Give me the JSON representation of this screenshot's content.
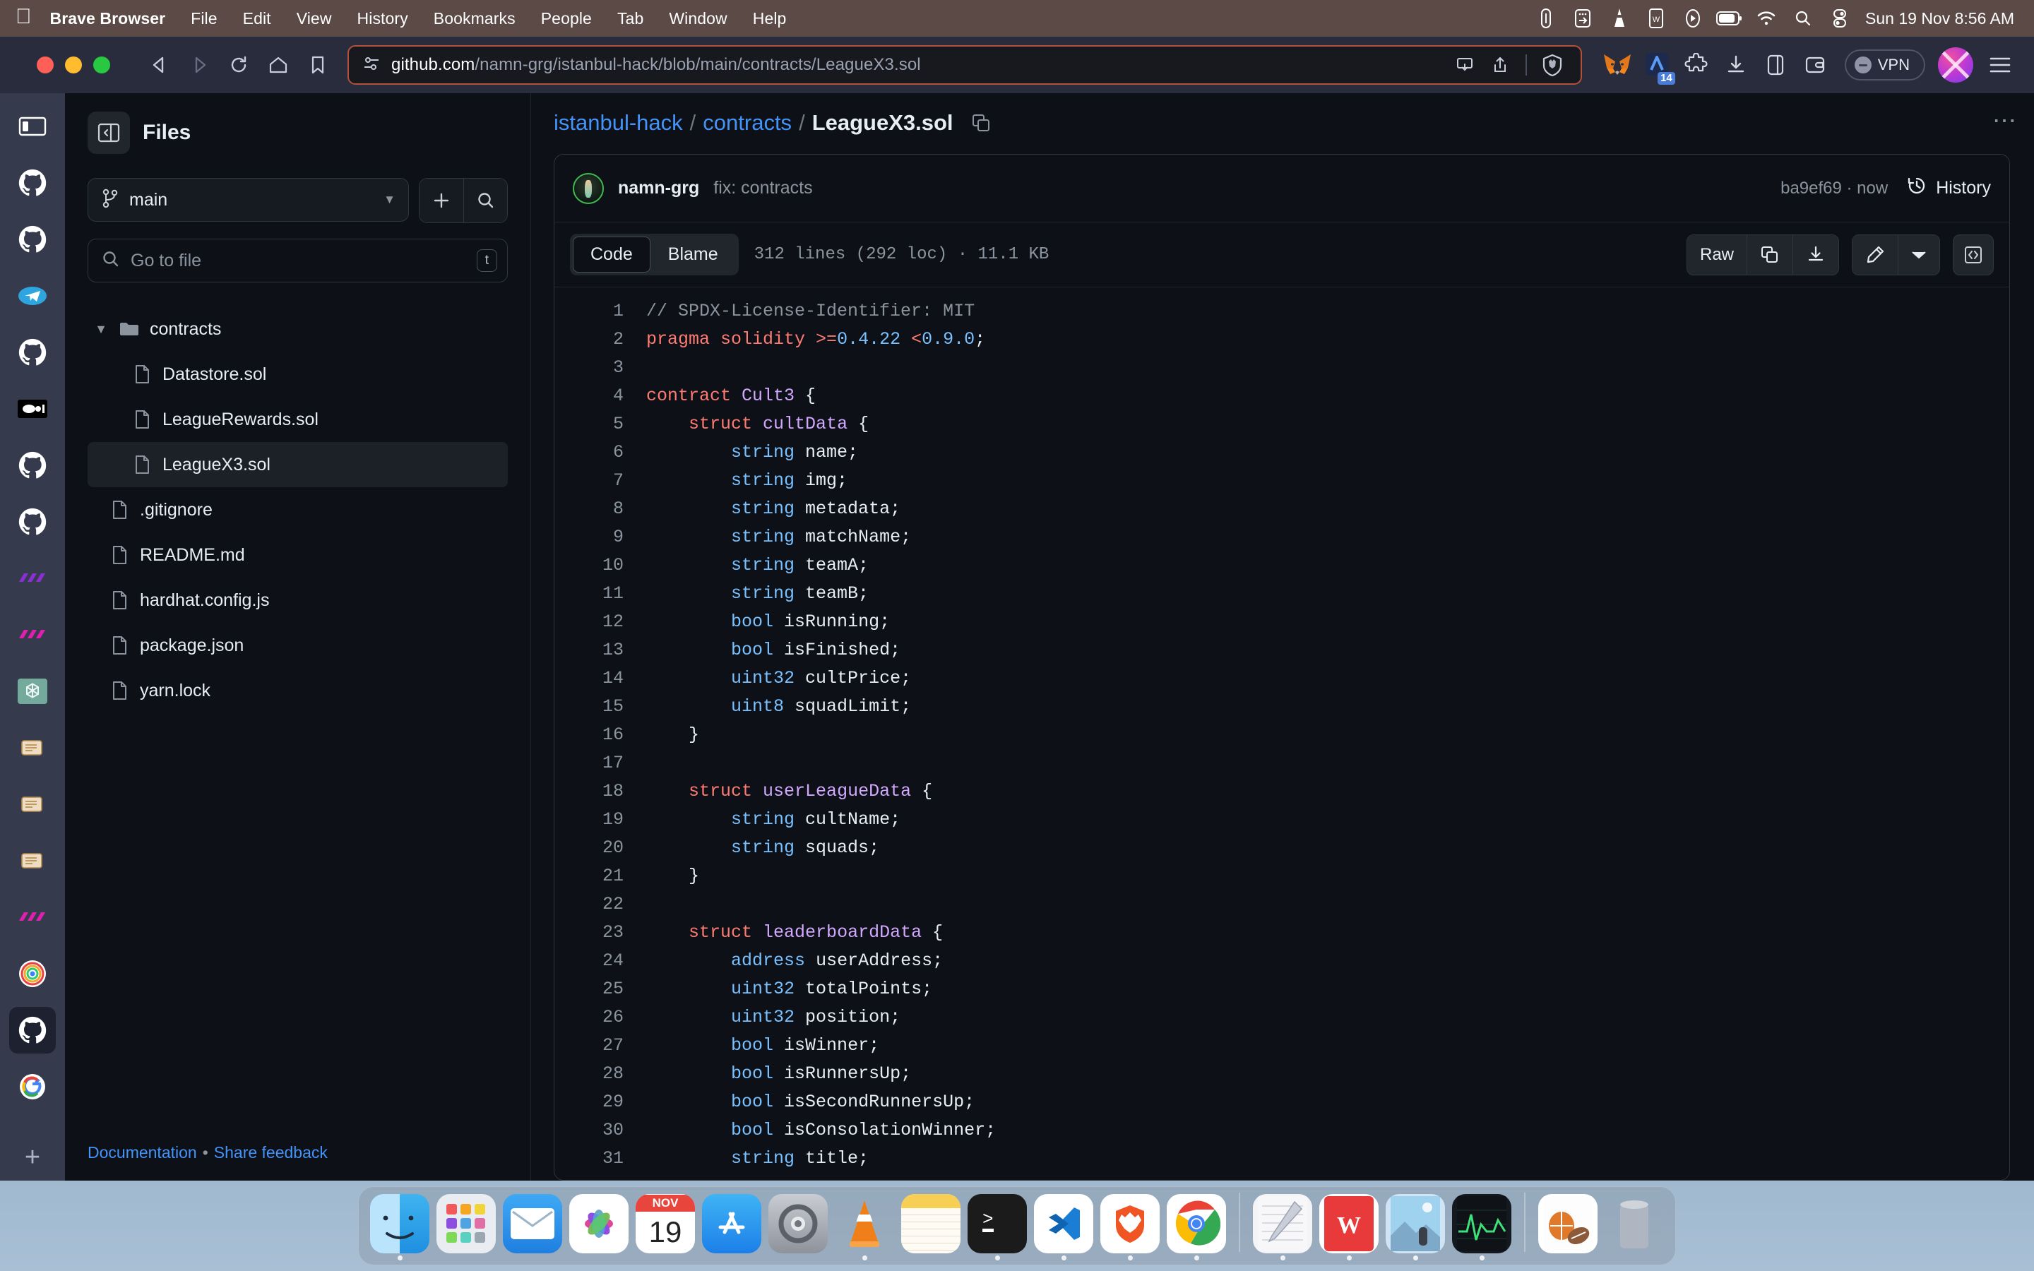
{
  "menubar": {
    "apple_icon": "apple-logo",
    "items": [
      "Brave Browser",
      "File",
      "Edit",
      "View",
      "History",
      "Bookmarks",
      "People",
      "Tab",
      "Window",
      "Help"
    ],
    "status_icons": [
      "paperclip-icon",
      "screen-mirroring-icon",
      "vlc-cone-icon",
      "wps-office-icon",
      "play-circle-icon",
      "battery-icon",
      "wifi-icon",
      "search-icon",
      "control-center-icon"
    ],
    "clock": "Sun 19 Nov  8:56 AM"
  },
  "browser": {
    "nav": {
      "back": "back-arrow-icon",
      "forward": "forward-arrow-icon",
      "reload": "reload-icon",
      "home": "home-icon",
      "bookmark": "bookmark-icon"
    },
    "url": {
      "site_settings_icon": "site-settings-icon",
      "host": "github.com",
      "path": "/namn-grg/istanbul-hack/blob/main/contracts/LeagueX3.sol",
      "full": "github.com/namn-grg/istanbul-hack/blob/main/contracts/LeagueX3.sol",
      "save_icon": "save-to-device-icon",
      "share_icon": "share-icon",
      "shields_icon": "brave-shields-icon"
    },
    "extensions": [
      {
        "name": "metamask-extension",
        "badge": ""
      },
      {
        "name": "calendar-extension",
        "badge": "14"
      },
      {
        "name": "puzzle-extension-icon",
        "badge": ""
      },
      {
        "name": "downloads-icon",
        "badge": ""
      },
      {
        "name": "sidebar-toggle-icon",
        "badge": ""
      },
      {
        "name": "brave-wallet-icon",
        "badge": ""
      }
    ],
    "vpn_label": "VPN",
    "profile_avatar": "profile-avatar",
    "menu_icon": "hamburger-menu-icon"
  },
  "tabstrip": {
    "toggle_icon": "sidebar-toggle-icon",
    "tabs": [
      {
        "name": "tab-github-1",
        "type": "github",
        "active": false
      },
      {
        "name": "tab-github-2",
        "type": "github",
        "active": false
      },
      {
        "name": "tab-telegram",
        "type": "telegram",
        "active": false
      },
      {
        "name": "tab-github-3",
        "type": "github",
        "active": false
      },
      {
        "name": "tab-media",
        "type": "media",
        "active": false
      },
      {
        "name": "tab-github-4",
        "type": "github",
        "active": false
      },
      {
        "name": "tab-github-5",
        "type": "github",
        "active": false
      },
      {
        "name": "tab-polygon-1",
        "type": "purple",
        "active": false
      },
      {
        "name": "tab-polygon-2",
        "type": "pink",
        "active": false
      },
      {
        "name": "tab-openai",
        "type": "openai",
        "active": false
      },
      {
        "name": "tab-docs-1",
        "type": "scroll",
        "active": false
      },
      {
        "name": "tab-docs-2",
        "type": "scroll",
        "active": false
      },
      {
        "name": "tab-docs-3",
        "type": "scroll",
        "active": false
      },
      {
        "name": "tab-polygon-3",
        "type": "pink",
        "active": false
      },
      {
        "name": "tab-rainbow",
        "type": "rainbow",
        "active": false
      },
      {
        "name": "tab-github-active",
        "type": "github",
        "active": true
      },
      {
        "name": "tab-google",
        "type": "google",
        "active": false
      }
    ],
    "new_tab_label": "+"
  },
  "files_pane": {
    "toggle_icon": "collapse-panel-icon",
    "title": "Files",
    "branch": "main",
    "branch_icon": "git-branch-icon",
    "add_icon": "plus-icon",
    "search_icon": "search-icon",
    "go_to_file_placeholder": "Go to file",
    "go_to_file_shortcut": "t",
    "tree": [
      {
        "label": "contracts",
        "type": "folder",
        "depth": 0,
        "expanded": true,
        "selected": false
      },
      {
        "label": "Datastore.sol",
        "type": "file",
        "depth": 1,
        "selected": false
      },
      {
        "label": "LeagueRewards.sol",
        "type": "file",
        "depth": 1,
        "selected": false
      },
      {
        "label": "LeagueX3.sol",
        "type": "file",
        "depth": 1,
        "selected": true
      },
      {
        "label": ".gitignore",
        "type": "file",
        "depth": 0,
        "selected": false
      },
      {
        "label": "README.md",
        "type": "file",
        "depth": 0,
        "selected": false
      },
      {
        "label": "hardhat.config.js",
        "type": "file",
        "depth": 0,
        "selected": false
      },
      {
        "label": "package.json",
        "type": "file",
        "depth": 0,
        "selected": false
      },
      {
        "label": "yarn.lock",
        "type": "file",
        "depth": 0,
        "selected": false
      }
    ],
    "footer": {
      "documentation": "Documentation",
      "separator": "•",
      "feedback": "Share feedback"
    }
  },
  "content": {
    "breadcrumb": {
      "repo": "istanbul-hack",
      "folder": "contracts",
      "file": "LeagueX3.sol",
      "sep": "/",
      "copy_icon": "copy-path-icon"
    },
    "commit": {
      "author": "namn-grg",
      "message": "fix: contracts",
      "hash_time": "ba9ef69 · now",
      "history_label": "History",
      "history_icon": "history-clock-icon"
    },
    "tabs": [
      {
        "label": "Code",
        "active": true
      },
      {
        "label": "Blame",
        "active": false
      }
    ],
    "file_meta": "312 lines (292 loc) · 11.1 KB",
    "actions": {
      "raw": "Raw",
      "copy_icon": "copy-icon",
      "download_icon": "download-icon",
      "edit_icon": "edit-pencil-icon",
      "edit_caret": "chevron-down-icon",
      "symbols_icon": "code-symbols-icon"
    },
    "kebab_icon": "more-options-icon",
    "code": [
      {
        "n": 1,
        "tokens": [
          {
            "t": "com",
            "v": "// SPDX-License-Identifier: MIT"
          }
        ]
      },
      {
        "n": 2,
        "tokens": [
          {
            "t": "kw",
            "v": "pragma solidity "
          },
          {
            "t": "kw",
            "v": ">="
          },
          {
            "t": "num",
            "v": "0.4.22"
          },
          {
            "t": "pln",
            "v": " "
          },
          {
            "t": "kw",
            "v": "<"
          },
          {
            "t": "num",
            "v": "0.9.0"
          },
          {
            "t": "pln",
            "v": ";"
          }
        ]
      },
      {
        "n": 3,
        "tokens": []
      },
      {
        "n": 4,
        "tokens": [
          {
            "t": "kw",
            "v": "contract "
          },
          {
            "t": "ent",
            "v": "Cult3"
          },
          {
            "t": "pln",
            "v": " {"
          }
        ]
      },
      {
        "n": 5,
        "tokens": [
          {
            "t": "pln",
            "v": "    "
          },
          {
            "t": "kw",
            "v": "struct "
          },
          {
            "t": "ent",
            "v": "cultData"
          },
          {
            "t": "pln",
            "v": " {"
          }
        ]
      },
      {
        "n": 6,
        "tokens": [
          {
            "t": "pln",
            "v": "        "
          },
          {
            "t": "typ",
            "v": "string"
          },
          {
            "t": "pln",
            "v": " name;"
          }
        ]
      },
      {
        "n": 7,
        "tokens": [
          {
            "t": "pln",
            "v": "        "
          },
          {
            "t": "typ",
            "v": "string"
          },
          {
            "t": "pln",
            "v": " img;"
          }
        ]
      },
      {
        "n": 8,
        "tokens": [
          {
            "t": "pln",
            "v": "        "
          },
          {
            "t": "typ",
            "v": "string"
          },
          {
            "t": "pln",
            "v": " metadata;"
          }
        ]
      },
      {
        "n": 9,
        "tokens": [
          {
            "t": "pln",
            "v": "        "
          },
          {
            "t": "typ",
            "v": "string"
          },
          {
            "t": "pln",
            "v": " matchName;"
          }
        ]
      },
      {
        "n": 10,
        "tokens": [
          {
            "t": "pln",
            "v": "        "
          },
          {
            "t": "typ",
            "v": "string"
          },
          {
            "t": "pln",
            "v": " teamA;"
          }
        ]
      },
      {
        "n": 11,
        "tokens": [
          {
            "t": "pln",
            "v": "        "
          },
          {
            "t": "typ",
            "v": "string"
          },
          {
            "t": "pln",
            "v": " teamB;"
          }
        ]
      },
      {
        "n": 12,
        "tokens": [
          {
            "t": "pln",
            "v": "        "
          },
          {
            "t": "typ",
            "v": "bool"
          },
          {
            "t": "pln",
            "v": " isRunning;"
          }
        ]
      },
      {
        "n": 13,
        "tokens": [
          {
            "t": "pln",
            "v": "        "
          },
          {
            "t": "typ",
            "v": "bool"
          },
          {
            "t": "pln",
            "v": " isFinished;"
          }
        ]
      },
      {
        "n": 14,
        "tokens": [
          {
            "t": "pln",
            "v": "        "
          },
          {
            "t": "typ",
            "v": "uint32"
          },
          {
            "t": "pln",
            "v": " cultPrice;"
          }
        ]
      },
      {
        "n": 15,
        "tokens": [
          {
            "t": "pln",
            "v": "        "
          },
          {
            "t": "typ",
            "v": "uint8"
          },
          {
            "t": "pln",
            "v": " squadLimit;"
          }
        ]
      },
      {
        "n": 16,
        "tokens": [
          {
            "t": "pln",
            "v": "    }"
          }
        ]
      },
      {
        "n": 17,
        "tokens": []
      },
      {
        "n": 18,
        "tokens": [
          {
            "t": "pln",
            "v": "    "
          },
          {
            "t": "kw",
            "v": "struct "
          },
          {
            "t": "ent",
            "v": "userLeagueData"
          },
          {
            "t": "pln",
            "v": " {"
          }
        ]
      },
      {
        "n": 19,
        "tokens": [
          {
            "t": "pln",
            "v": "        "
          },
          {
            "t": "typ",
            "v": "string"
          },
          {
            "t": "pln",
            "v": " cultName;"
          }
        ]
      },
      {
        "n": 20,
        "tokens": [
          {
            "t": "pln",
            "v": "        "
          },
          {
            "t": "typ",
            "v": "string"
          },
          {
            "t": "pln",
            "v": " squads;"
          }
        ]
      },
      {
        "n": 21,
        "tokens": [
          {
            "t": "pln",
            "v": "    }"
          }
        ]
      },
      {
        "n": 22,
        "tokens": []
      },
      {
        "n": 23,
        "tokens": [
          {
            "t": "pln",
            "v": "    "
          },
          {
            "t": "kw",
            "v": "struct "
          },
          {
            "t": "ent",
            "v": "leaderboardData"
          },
          {
            "t": "pln",
            "v": " {"
          }
        ]
      },
      {
        "n": 24,
        "tokens": [
          {
            "t": "pln",
            "v": "        "
          },
          {
            "t": "typ",
            "v": "address"
          },
          {
            "t": "pln",
            "v": " userAddress;"
          }
        ]
      },
      {
        "n": 25,
        "tokens": [
          {
            "t": "pln",
            "v": "        "
          },
          {
            "t": "typ",
            "v": "uint32"
          },
          {
            "t": "pln",
            "v": " totalPoints;"
          }
        ]
      },
      {
        "n": 26,
        "tokens": [
          {
            "t": "pln",
            "v": "        "
          },
          {
            "t": "typ",
            "v": "uint32"
          },
          {
            "t": "pln",
            "v": " position;"
          }
        ]
      },
      {
        "n": 27,
        "tokens": [
          {
            "t": "pln",
            "v": "        "
          },
          {
            "t": "typ",
            "v": "bool"
          },
          {
            "t": "pln",
            "v": " isWinner;"
          }
        ]
      },
      {
        "n": 28,
        "tokens": [
          {
            "t": "pln",
            "v": "        "
          },
          {
            "t": "typ",
            "v": "bool"
          },
          {
            "t": "pln",
            "v": " isRunnersUp;"
          }
        ]
      },
      {
        "n": 29,
        "tokens": [
          {
            "t": "pln",
            "v": "        "
          },
          {
            "t": "typ",
            "v": "bool"
          },
          {
            "t": "pln",
            "v": " isSecondRunnersUp;"
          }
        ]
      },
      {
        "n": 30,
        "tokens": [
          {
            "t": "pln",
            "v": "        "
          },
          {
            "t": "typ",
            "v": "bool"
          },
          {
            "t": "pln",
            "v": " isConsolationWinner;"
          }
        ]
      },
      {
        "n": 31,
        "tokens": [
          {
            "t": "pln",
            "v": "        "
          },
          {
            "t": "typ",
            "v": "string"
          },
          {
            "t": "pln",
            "v": " title;"
          }
        ]
      }
    ]
  },
  "dock": {
    "items": [
      {
        "name": "finder",
        "running": true
      },
      {
        "name": "launchpad",
        "running": false
      },
      {
        "name": "mail",
        "running": false
      },
      {
        "name": "photos",
        "running": false
      },
      {
        "name": "calendar",
        "running": false,
        "month": "NOV",
        "day": "19"
      },
      {
        "name": "app-store",
        "running": false
      },
      {
        "name": "system-settings",
        "running": false
      },
      {
        "name": "vlc",
        "running": true
      },
      {
        "name": "notes",
        "running": false
      },
      {
        "name": "terminal",
        "running": true
      },
      {
        "name": "visual-studio-code",
        "running": true
      },
      {
        "name": "brave-browser",
        "running": true
      },
      {
        "name": "google-chrome",
        "running": true
      },
      {
        "name": "sep",
        "running": false
      },
      {
        "name": "notepad",
        "running": true
      },
      {
        "name": "wps-office",
        "running": true
      },
      {
        "name": "preview-image",
        "running": true
      },
      {
        "name": "activity-monitor",
        "running": true
      },
      {
        "name": "sep",
        "running": false
      },
      {
        "name": "downloads-stack",
        "running": false
      },
      {
        "name": "trash",
        "running": false
      }
    ]
  },
  "colors": {
    "accent_blue": "#2f81f7",
    "link_blue": "#4493f8",
    "bg": "#0d1117",
    "border": "#30363d",
    "brave_orange": "#b5503a",
    "menubar_bg": "#5b4a45"
  }
}
